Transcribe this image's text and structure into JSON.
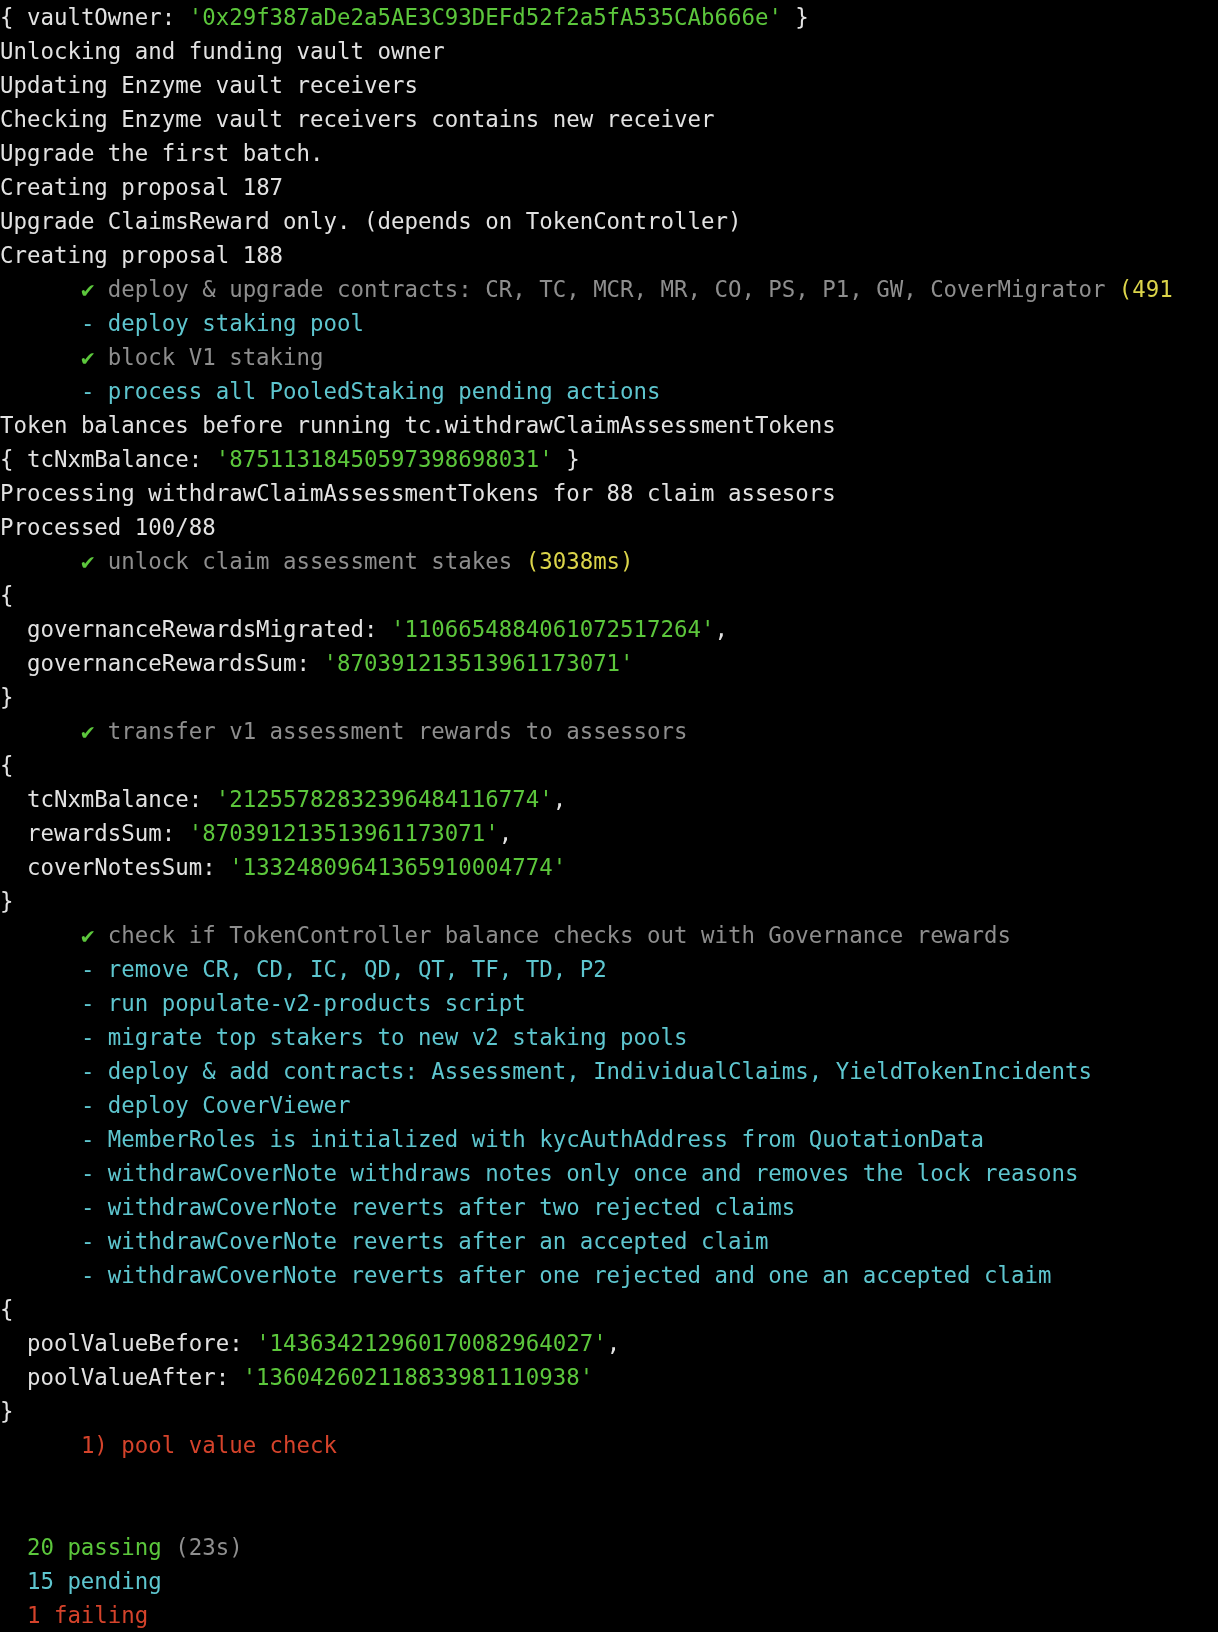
{
  "output": [
    {
      "kind": "log",
      "segments": [
        {
          "text": "{ vaultOwner: ",
          "kind": "plain"
        },
        {
          "text": "'0x29f387aDe2a5AE3C93DEFd52f2a5fA535CAb666e'",
          "kind": "string"
        },
        {
          "text": " }",
          "kind": "plain"
        }
      ]
    },
    {
      "kind": "log",
      "segments": [
        {
          "text": "Unlocking and funding vault owner",
          "kind": "plain"
        }
      ]
    },
    {
      "kind": "log",
      "segments": [
        {
          "text": "Updating Enzyme vault receivers",
          "kind": "plain"
        }
      ]
    },
    {
      "kind": "log",
      "segments": [
        {
          "text": "Checking Enzyme vault receivers contains new receiver",
          "kind": "plain"
        }
      ]
    },
    {
      "kind": "log",
      "segments": [
        {
          "text": "Upgrade the first batch.",
          "kind": "plain"
        }
      ]
    },
    {
      "kind": "log",
      "segments": [
        {
          "text": "Creating proposal 187",
          "kind": "plain"
        }
      ]
    },
    {
      "kind": "log",
      "segments": [
        {
          "text": "Upgrade ClaimsReward only. (depends on TokenController)",
          "kind": "plain"
        }
      ]
    },
    {
      "kind": "log",
      "segments": [
        {
          "text": "Creating proposal 188",
          "kind": "plain"
        }
      ]
    },
    {
      "kind": "test",
      "segments": [
        {
          "text": "✔",
          "kind": "pass"
        },
        {
          "text": " deploy & upgrade contracts: CR, TC, MCR, MR, CO, PS, P1, GW, CoverMigrator",
          "kind": "muted"
        },
        {
          "text": " (491",
          "kind": "slow"
        }
      ]
    },
    {
      "kind": "test",
      "segments": [
        {
          "text": "- deploy staking pool",
          "kind": "pending"
        }
      ]
    },
    {
      "kind": "test",
      "segments": [
        {
          "text": "✔",
          "kind": "pass"
        },
        {
          "text": " block V1 staking",
          "kind": "muted"
        }
      ]
    },
    {
      "kind": "test",
      "segments": [
        {
          "text": "- process all PooledStaking pending actions",
          "kind": "pending"
        }
      ]
    },
    {
      "kind": "log",
      "segments": [
        {
          "text": "Token balances before running tc.withdrawClaimAssessmentTokens",
          "kind": "plain"
        }
      ]
    },
    {
      "kind": "log",
      "segments": [
        {
          "text": "{ tcNxmBalance: ",
          "kind": "plain"
        },
        {
          "text": "'87511318450597398698031'",
          "kind": "string"
        },
        {
          "text": " }",
          "kind": "plain"
        }
      ]
    },
    {
      "kind": "log",
      "segments": [
        {
          "text": "Processing withdrawClaimAssessmentTokens for 88 claim assesors",
          "kind": "plain"
        }
      ]
    },
    {
      "kind": "log",
      "segments": [
        {
          "text": "Processed 100/88",
          "kind": "plain"
        }
      ]
    },
    {
      "kind": "test",
      "segments": [
        {
          "text": "✔",
          "kind": "pass"
        },
        {
          "text": " unlock claim assessment stakes",
          "kind": "muted"
        },
        {
          "text": " (3038ms)",
          "kind": "slow"
        }
      ]
    },
    {
      "kind": "log",
      "segments": [
        {
          "text": "{",
          "kind": "plain"
        }
      ]
    },
    {
      "kind": "field",
      "segments": [
        {
          "text": "governanceRewardsMigrated: ",
          "kind": "plain"
        },
        {
          "text": "'1106654884061072517264'",
          "kind": "string"
        },
        {
          "text": ",",
          "kind": "plain"
        }
      ]
    },
    {
      "kind": "field",
      "segments": [
        {
          "text": "governanceRewardsSum: ",
          "kind": "plain"
        },
        {
          "text": "'870391213513961173071'",
          "kind": "string"
        }
      ]
    },
    {
      "kind": "log",
      "segments": [
        {
          "text": "}",
          "kind": "plain"
        }
      ]
    },
    {
      "kind": "test",
      "segments": [
        {
          "text": "✔",
          "kind": "pass"
        },
        {
          "text": " transfer v1 assessment rewards to assessors",
          "kind": "muted"
        }
      ]
    },
    {
      "kind": "log",
      "segments": [
        {
          "text": "{",
          "kind": "plain"
        }
      ]
    },
    {
      "kind": "field",
      "segments": [
        {
          "text": "tcNxmBalance: ",
          "kind": "plain"
        },
        {
          "text": "'21255782832396484116774'",
          "kind": "string"
        },
        {
          "text": ",",
          "kind": "plain"
        }
      ]
    },
    {
      "kind": "field",
      "segments": [
        {
          "text": "rewardsSum: ",
          "kind": "plain"
        },
        {
          "text": "'870391213513961173071'",
          "kind": "string"
        },
        {
          "text": ",",
          "kind": "plain"
        }
      ]
    },
    {
      "kind": "field",
      "segments": [
        {
          "text": "coverNotesSum: ",
          "kind": "plain"
        },
        {
          "text": "'13324809641365910004774'",
          "kind": "string"
        }
      ]
    },
    {
      "kind": "log",
      "segments": [
        {
          "text": "}",
          "kind": "plain"
        }
      ]
    },
    {
      "kind": "test",
      "segments": [
        {
          "text": "✔",
          "kind": "pass"
        },
        {
          "text": " check if TokenController balance checks out with Governance rewards",
          "kind": "muted"
        }
      ]
    },
    {
      "kind": "test",
      "segments": [
        {
          "text": "- remove CR, CD, IC, QD, QT, TF, TD, P2",
          "kind": "pending"
        }
      ]
    },
    {
      "kind": "test",
      "segments": [
        {
          "text": "- run populate-v2-products script",
          "kind": "pending"
        }
      ]
    },
    {
      "kind": "test",
      "segments": [
        {
          "text": "- migrate top stakers to new v2 staking pools",
          "kind": "pending"
        }
      ]
    },
    {
      "kind": "test",
      "segments": [
        {
          "text": "- deploy & add contracts: Assessment, IndividualClaims, YieldTokenIncidents",
          "kind": "pending"
        }
      ]
    },
    {
      "kind": "test",
      "segments": [
        {
          "text": "- deploy CoverViewer",
          "kind": "pending"
        }
      ]
    },
    {
      "kind": "test",
      "segments": [
        {
          "text": "- MemberRoles is initialized with kycAuthAddress from QuotationData",
          "kind": "pending"
        }
      ]
    },
    {
      "kind": "test",
      "segments": [
        {
          "text": "- withdrawCoverNote withdraws notes only once and removes the lock reasons",
          "kind": "pending"
        }
      ]
    },
    {
      "kind": "test",
      "segments": [
        {
          "text": "- withdrawCoverNote reverts after two rejected claims",
          "kind": "pending"
        }
      ]
    },
    {
      "kind": "test",
      "segments": [
        {
          "text": "- withdrawCoverNote reverts after an accepted claim",
          "kind": "pending"
        }
      ]
    },
    {
      "kind": "test",
      "segments": [
        {
          "text": "- withdrawCoverNote reverts after one rejected and one an accepted claim",
          "kind": "pending"
        }
      ]
    },
    {
      "kind": "log",
      "segments": [
        {
          "text": "{",
          "kind": "plain"
        }
      ]
    },
    {
      "kind": "field",
      "segments": [
        {
          "text": "poolValueBefore: ",
          "kind": "plain"
        },
        {
          "text": "'143634212960170082964027'",
          "kind": "string"
        },
        {
          "text": ",",
          "kind": "plain"
        }
      ]
    },
    {
      "kind": "field",
      "segments": [
        {
          "text": "poolValueAfter: ",
          "kind": "plain"
        },
        {
          "text": "'136042602118833981110938'",
          "kind": "string"
        }
      ]
    },
    {
      "kind": "log",
      "segments": [
        {
          "text": "}",
          "kind": "plain"
        }
      ]
    },
    {
      "kind": "test",
      "segments": [
        {
          "text": "1) pool value check",
          "kind": "fail"
        }
      ]
    }
  ],
  "summary": [
    {
      "segments": [
        {
          "text": "20 passing",
          "kind": "string"
        },
        {
          "text": " (23s)",
          "kind": "muted"
        }
      ]
    },
    {
      "segments": [
        {
          "text": "15 pending",
          "kind": "pending"
        }
      ]
    },
    {
      "segments": [
        {
          "text": "1 failing",
          "kind": "fail"
        }
      ]
    }
  ]
}
